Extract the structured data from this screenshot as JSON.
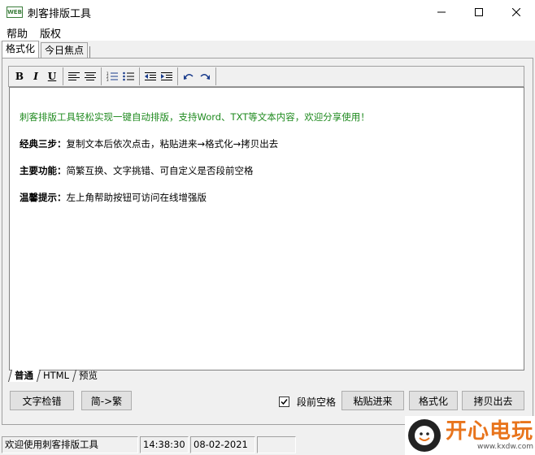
{
  "window": {
    "title": "刺客排版工具",
    "icon_text": "WEB"
  },
  "menu": {
    "items": [
      "帮助",
      "版权"
    ]
  },
  "top_tabs": [
    {
      "label": "格式化"
    },
    {
      "label": "今日焦点"
    }
  ],
  "toolbar": {
    "bold": "B",
    "italic": "I",
    "underline": "U"
  },
  "editor": {
    "intro": "刺客排版工具轻松实现一键自动排版，支持Word、TXT等文本内容，欢迎分享使用！",
    "lines": [
      {
        "label": "经典三步：",
        "text": "复制文本后依次点击，粘贴进来→格式化→拷贝出去"
      },
      {
        "label": "主要功能：",
        "text": "简繁互换、文字挑错、可自定义是否段前空格"
      },
      {
        "label": "温馨提示：",
        "text": "左上角帮助按钮可访问在线增强版"
      }
    ]
  },
  "bottom_tabs": [
    {
      "label": "普通"
    },
    {
      "label": "HTML"
    },
    {
      "label": "预览"
    }
  ],
  "buttons": {
    "spellcheck": "文字检错",
    "convert": "简->繁",
    "indent_label": "段前空格",
    "paste": "粘贴进来",
    "format": "格式化",
    "copy_out": "拷贝出去"
  },
  "status": {
    "message": "欢迎使用刺客排版工具",
    "time": "14:38:30",
    "date": "08-02-2021"
  },
  "watermark": {
    "brand": "开心电玩",
    "url": "www.kxdw.com"
  },
  "colors": {
    "intro_text": "#1f8a1f",
    "toolbar_icon": "#1a3c8c",
    "watermark": "#e8741c"
  }
}
